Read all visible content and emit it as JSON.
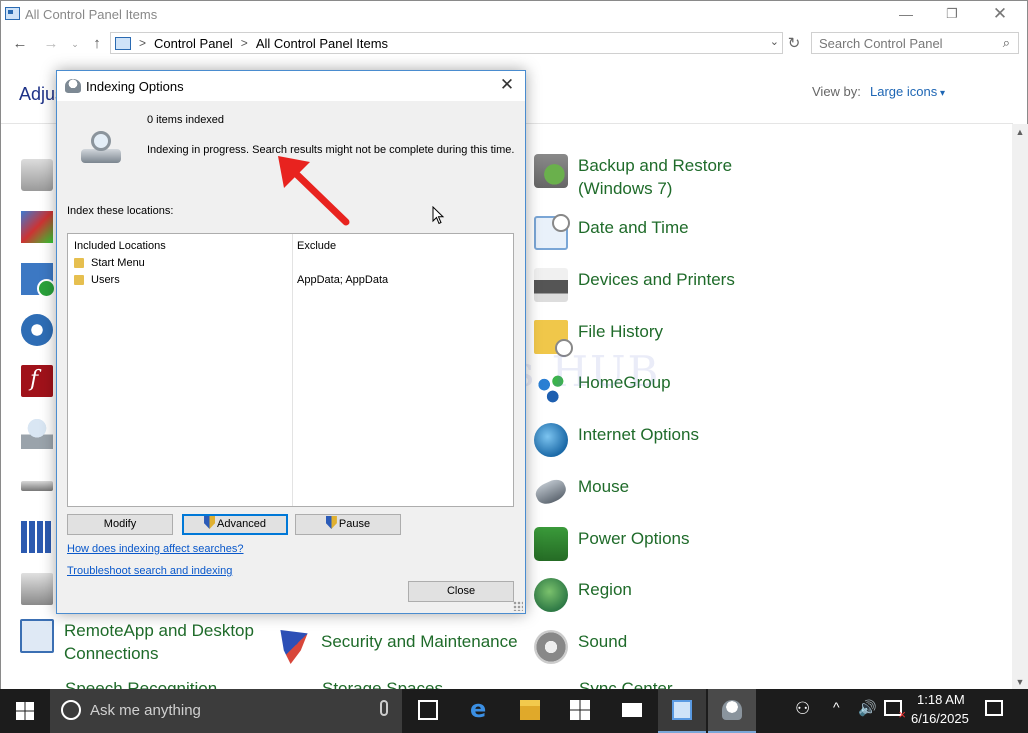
{
  "window": {
    "title": "All Control Panel Items",
    "minimize": "—",
    "maximize": "❐",
    "close": "✕"
  },
  "nav": {
    "back": "←",
    "forward": "→",
    "recent": "⌄",
    "up": "↑",
    "breadcrumb": [
      "Control Panel",
      "All Control Panel Items"
    ],
    "separator": ">",
    "dropdown": "⌄",
    "refresh": "↻",
    "search_placeholder": "Search Control Panel",
    "search_glyph": "⌕"
  },
  "header": {
    "heading": "Adjust your computer's settings",
    "view_by_label": "View by:",
    "view_by_value": "Large icons"
  },
  "items_right": [
    {
      "label": "Backup and Restore\n(Windows 7)",
      "icon": "backup-icon"
    },
    {
      "label": "Date and Time",
      "icon": "date-time-icon"
    },
    {
      "label": "Devices and Printers",
      "icon": "printer-icon"
    },
    {
      "label": "File History",
      "icon": "file-history-icon"
    },
    {
      "label": "HomeGroup",
      "icon": "homegroup-icon"
    },
    {
      "label": "Internet Options",
      "icon": "internet-options-icon"
    },
    {
      "label": "Mouse",
      "icon": "mouse-icon"
    },
    {
      "label": "Power Options",
      "icon": "power-options-icon"
    },
    {
      "label": "Region",
      "icon": "region-icon"
    },
    {
      "label": "Sound",
      "icon": "sound-icon"
    }
  ],
  "items_bottom": [
    {
      "label": "RemoteApp and Desktop\nConnections",
      "icon": "remoteapp-icon"
    },
    {
      "label": "Security and Maintenance",
      "icon": "security-maintenance-icon"
    }
  ],
  "partial_items": [
    "Speech Recognition",
    "Storage Spaces",
    "Sync Center"
  ],
  "watermark": "IT Pros HUB",
  "scrollbar": {
    "up": "▲",
    "down": "▼"
  },
  "dialog": {
    "title": "Indexing Options",
    "close": "✕",
    "items_indexed": "0 items indexed",
    "status": "Indexing in progress. Search results might not be complete during this time.",
    "locations_label": "Index these locations:",
    "columns": {
      "included": "Included Locations",
      "exclude": "Exclude"
    },
    "locations": [
      {
        "name": "Start Menu",
        "exclude": ""
      },
      {
        "name": "Users",
        "exclude": "AppData; AppData"
      }
    ],
    "buttons": {
      "modify": "Modify",
      "advanced": "Advanced",
      "pause": "Pause",
      "close": "Close"
    },
    "links": {
      "how": "How does indexing affect searches?",
      "troubleshoot": "Troubleshoot search and indexing"
    }
  },
  "annotation": {
    "arrow_color": "#e8231f"
  },
  "taskbar": {
    "search_text": "Ask me anything",
    "time": "1:18 AM",
    "date": "6/16/2025",
    "people_glyph": "⚇",
    "chevron_glyph": "^",
    "volume_glyph": "🔊"
  },
  "colors": {
    "link_green": "#1f6b2a",
    "heading_blue": "#1e3287",
    "accent_blue": "#0078d7",
    "taskbar": "#1c1c1c"
  }
}
